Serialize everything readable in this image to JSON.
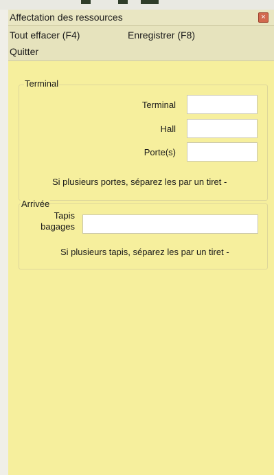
{
  "window": {
    "title": "Affectation des ressources",
    "close_glyph": "×"
  },
  "menu": {
    "clear_all": "Tout effacer (F4)",
    "save": "Enregistrer (F8)",
    "quit": "Quitter"
  },
  "terminal_group": {
    "legend": "Terminal",
    "terminal_label": "Terminal",
    "terminal_value": "",
    "hall_label": "Hall",
    "hall_value": "",
    "gates_label": "Porte(s)",
    "gates_value": "",
    "hint": "Si plusieurs portes, séparez les par un tiret  -"
  },
  "arrival_group": {
    "legend": "Arrivée",
    "belt_label_line1": "Tapis",
    "belt_label_line2": "bagages",
    "belt_value": "",
    "hint": "Si plusieurs tapis, séparez les par un tiret  -"
  },
  "colors": {
    "window_background": "#f6ef9d",
    "titlebar": "#e9e6c2",
    "close_button": "#d2694e"
  }
}
